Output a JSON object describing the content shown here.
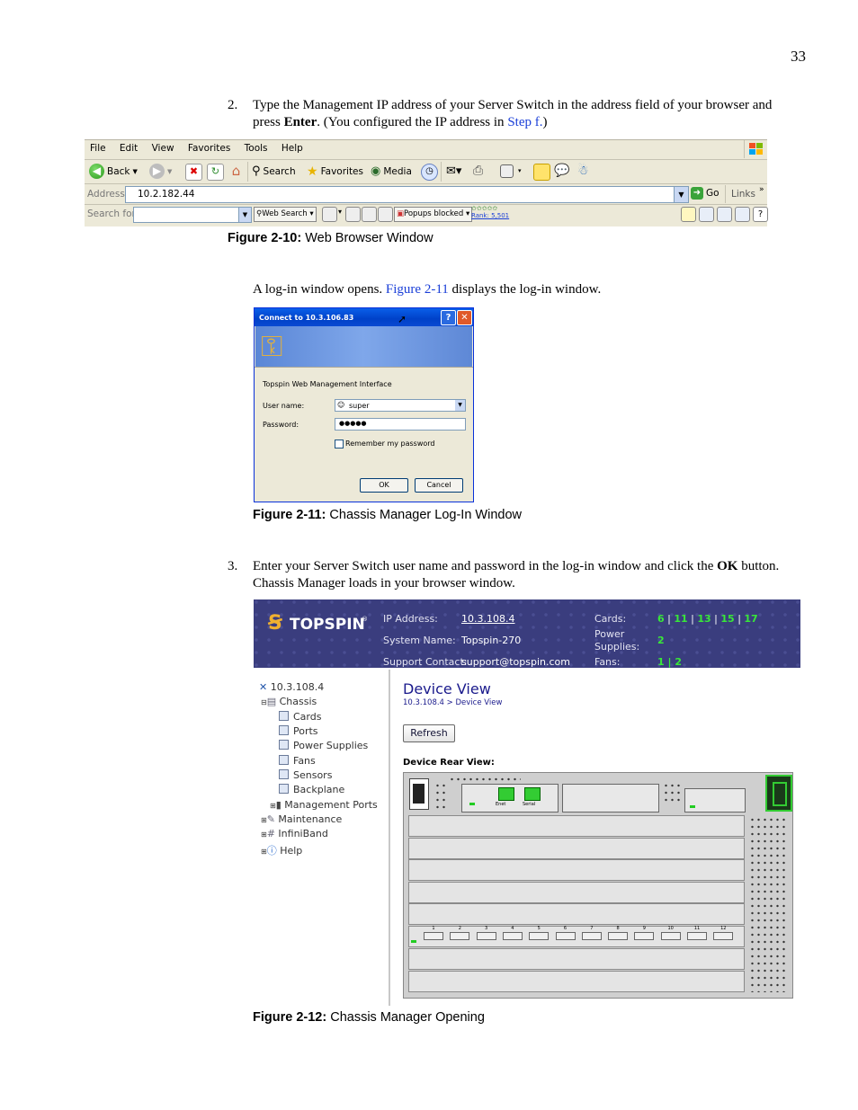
{
  "page_number": "33",
  "step2": {
    "num": "2.",
    "line1": "Type the Management IP address of your Server Switch in the address field of your browser and",
    "line2_a": "press ",
    "line2_bold": "Enter",
    "line2_b": ". (You configured the IP address in ",
    "line2_link": "Step f.",
    "line2_c": ")"
  },
  "browser": {
    "menu": [
      "File",
      "Edit",
      "View",
      "Favorites",
      "Tools",
      "Help"
    ],
    "back_label": "Back",
    "search_label": "Search",
    "favorites_label": "Favorites",
    "media_label": "Media",
    "address_label": "Address",
    "address_value": "10.2.182.44",
    "go_label": "Go",
    "links_label": "Links",
    "searchfor_label": "Search for",
    "websearch_label": "Web Search",
    "popups_label": "Popups blocked",
    "rank_label": "Rank: 5,501"
  },
  "fig10_caption": {
    "bold": "Figure 2-10:",
    "text": " Web Browser Window"
  },
  "login_intro": {
    "a": "A log-in window opens. ",
    "link": "Figure 2-11",
    "b": " displays the log-in window."
  },
  "login": {
    "title": "Connect to 10.3.106.83",
    "realm": "Topspin Web Management Interface",
    "username_label": "User name:",
    "username_value": "super",
    "password_label": "Password:",
    "password_value": "●●●●●",
    "remember_label": "Remember my password",
    "ok_label": "OK",
    "cancel_label": "Cancel"
  },
  "fig11_caption": {
    "bold": "Figure 2-11:",
    "text": " Chassis Manager Log-In Window"
  },
  "step3": {
    "num": "3.",
    "line1_a": "Enter your Server Switch user name and password in the log-in window and click the ",
    "line1_bold": "OK",
    "line1_b": " button.",
    "line2": "Chassis Manager loads in your browser window."
  },
  "cm": {
    "brand": "TOPSPIN",
    "ip_label": "IP Address:",
    "ip_value": "10.3.108.4",
    "sysname_label": "System Name:",
    "sysname_value": "Topspin-270",
    "contact_label": "Support Contact:",
    "contact_value": "support@topspin.com",
    "cards_label": "Cards:",
    "cards_values": [
      "6",
      "11",
      "13",
      "15",
      "17"
    ],
    "power_label_1": "Power",
    "power_label_2": "Supplies:",
    "power_value": "2",
    "fans_label": "Fans:",
    "fans_value": "1 | 2",
    "tree": [
      "10.3.108.4",
      "Chassis",
      "Cards",
      "Ports",
      "Power Supplies",
      "Fans",
      "Sensors",
      "Backplane",
      "Management Ports",
      "Maintenance",
      "InfiniBand",
      "Help"
    ],
    "view_title": "Device View",
    "breadcrumb": "10.3.108.4 > Device View",
    "refresh_label": "Refresh",
    "rear_label": "Device Rear View:",
    "enet_label": "Enet",
    "serial_label": "Serial",
    "ports": [
      "1",
      "2",
      "3",
      "4",
      "5",
      "6",
      "7",
      "8",
      "9",
      "10",
      "11",
      "12"
    ]
  },
  "fig12_caption": {
    "bold": "Figure 2-12:",
    "text": " Chassis Manager Opening"
  }
}
